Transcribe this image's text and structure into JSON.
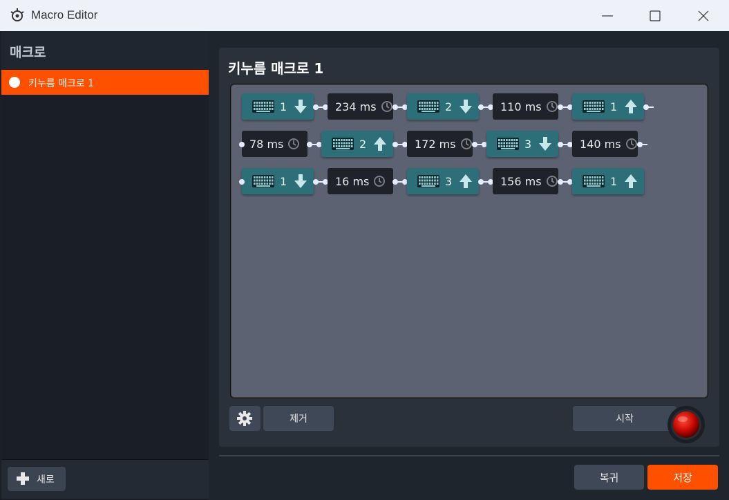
{
  "window": {
    "title": "Macro Editor",
    "controls": [
      "minimize-icon",
      "maximize-icon",
      "close-icon"
    ]
  },
  "sidebar": {
    "title": "매크로",
    "items": [
      {
        "label": "키누름 매크로 1",
        "selected": true
      }
    ],
    "new_label": "새로"
  },
  "editor": {
    "title": "키누름 매크로 1",
    "rows": [
      [
        {
          "type": "key",
          "key": "1",
          "direction": "down"
        },
        {
          "type": "delay",
          "label": "234 ms"
        },
        {
          "type": "key",
          "key": "2",
          "direction": "down"
        },
        {
          "type": "delay",
          "label": "110 ms"
        },
        {
          "type": "key",
          "key": "1",
          "direction": "up"
        }
      ],
      [
        {
          "type": "delay",
          "label": "78 ms"
        },
        {
          "type": "key",
          "key": "2",
          "direction": "up"
        },
        {
          "type": "delay",
          "label": "172 ms"
        },
        {
          "type": "key",
          "key": "3",
          "direction": "down"
        },
        {
          "type": "delay",
          "label": "140 ms"
        }
      ],
      [
        {
          "type": "key",
          "key": "1",
          "direction": "down"
        },
        {
          "type": "delay",
          "label": "16 ms"
        },
        {
          "type": "key",
          "key": "3",
          "direction": "up"
        },
        {
          "type": "delay",
          "label": "156 ms"
        },
        {
          "type": "key",
          "key": "1",
          "direction": "up"
        }
      ]
    ],
    "remove_label": "제거",
    "start_label": "시작"
  },
  "footer": {
    "revert_label": "복귀",
    "save_label": "저장"
  },
  "colors": {
    "accent": "#ff5000",
    "key_node": "#2c6f78",
    "delay_node": "#1f2228",
    "canvas": "#5d6272"
  }
}
